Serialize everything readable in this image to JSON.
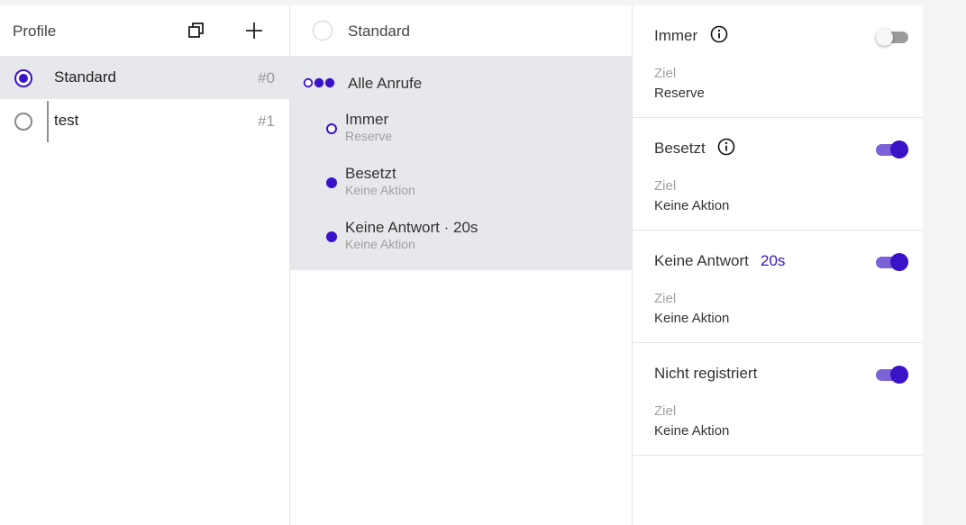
{
  "colors": {
    "accent": "#3a12c8",
    "toggle_track_on": "#7b62d9",
    "selected_bg": "#e6e8eb",
    "muted_text": "#a0a0a0"
  },
  "profiles_panel": {
    "title": "Profile",
    "copy_icon": "copy-icon",
    "add_icon": "plus-icon",
    "items": [
      {
        "name": "Standard",
        "number": "#0",
        "selected": true
      },
      {
        "name": "test",
        "number": "#1",
        "selected": false
      }
    ]
  },
  "rules_panel": {
    "profile_title": "Standard",
    "all_calls_label": "Alle Anrufe",
    "rules": [
      {
        "title": "Immer",
        "subtitle": "Reserve",
        "active": false
      },
      {
        "title": "Besetzt",
        "subtitle": "Keine Aktion",
        "active": true
      },
      {
        "title": "Keine Antwort · 20s",
        "subtitle": "Keine Aktion",
        "active": true
      }
    ]
  },
  "settings_panel": {
    "ziel_label": "Ziel",
    "settings": [
      {
        "title": "Immer",
        "has_info": true,
        "enabled": false,
        "target": "Reserve"
      },
      {
        "title": "Besetzt",
        "has_info": true,
        "enabled": true,
        "target": "Keine Aktion"
      },
      {
        "title": "Keine Antwort",
        "delay": "20s",
        "enabled": true,
        "target": "Keine Aktion"
      },
      {
        "title": "Nicht registriert",
        "enabled": true,
        "target": "Keine Aktion"
      }
    ]
  }
}
